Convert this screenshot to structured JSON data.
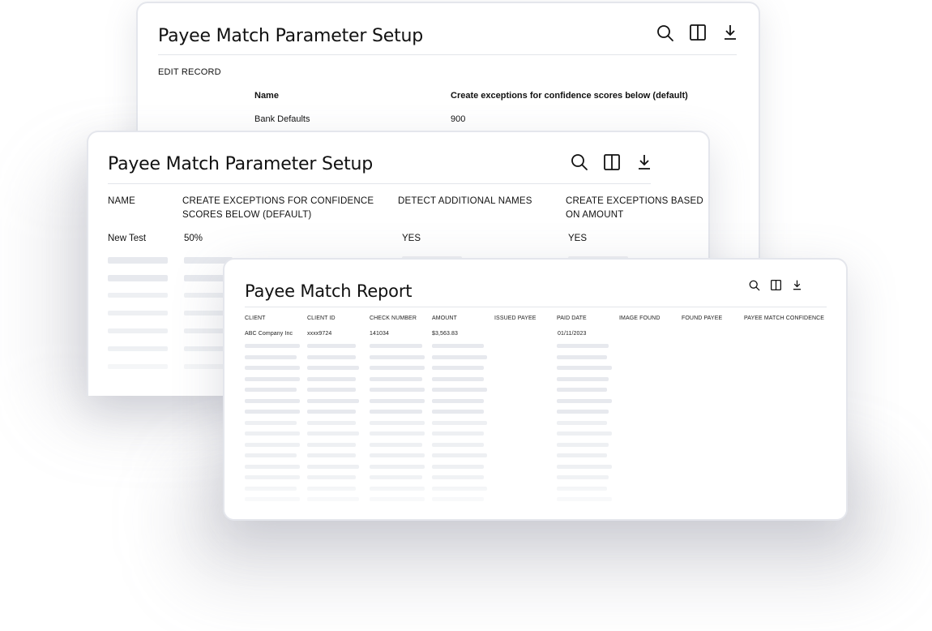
{
  "back_panel": {
    "title": "Payee Match Parameter Setup",
    "section_label": "EDIT RECORD",
    "col_name": "Name",
    "col_confidence": "Create exceptions for confidence scores below  (default)",
    "row_name": "Bank Defaults",
    "row_confidence": "900",
    "icons": [
      "search-icon",
      "columns-icon",
      "download-icon"
    ]
  },
  "middle_panel": {
    "title": "Payee Match Parameter Setup",
    "headers": [
      "NAME",
      "CREATE EXCEPTIONS FOR CONFIDENCE",
      "SCORES BELOW  (DEFAULT)",
      "DETECT ADDITIONAL NAMES",
      "CREATE EXCEPTIONS BASED",
      "ON AMOUNT"
    ],
    "row": {
      "name": "New Test",
      "confidence": "50%",
      "detect": "YES",
      "amount": "YES"
    },
    "icons": [
      "search-icon",
      "columns-icon",
      "download-icon"
    ]
  },
  "front_panel": {
    "title": "Payee Match Report",
    "headers": [
      "CLIENT",
      "CLIENT ID",
      "CHECK NUMBER",
      "AMOUNT",
      "ISSUED PAYEE",
      "PAID DATE",
      "IMAGE FOUND",
      "FOUND PAYEE",
      "PAYEE MATCH CONFIDENCE"
    ],
    "row": {
      "client": "ABC Company Inc",
      "client_id": "xxxx9724",
      "check_number": "141034",
      "amount": "$3,563.83",
      "paid_date": "01/11/2023"
    },
    "icons": [
      "search-icon",
      "columns-icon",
      "download-icon"
    ]
  }
}
